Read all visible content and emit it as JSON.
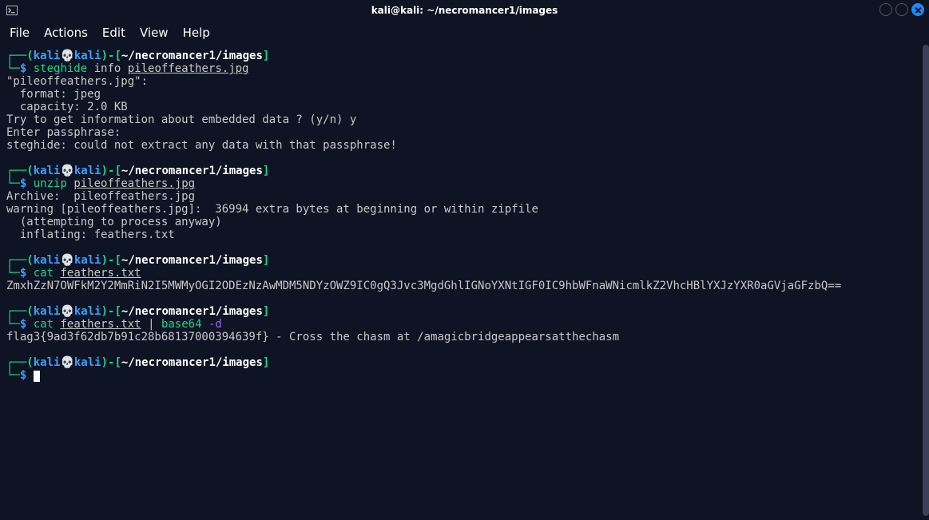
{
  "window": {
    "title": "kali@kali: ~/necromancer1/images"
  },
  "menu": {
    "file": "File",
    "actions": "Actions",
    "edit": "Edit",
    "view": "View",
    "help": "Help"
  },
  "prompt": {
    "user": "kali",
    "host": "kali",
    "path": "~/necromancer1/images",
    "skull": "💀"
  },
  "cmd1": {
    "bin": "steghide",
    "args": "info",
    "file": "pileoffeathers.jpg"
  },
  "out1": {
    "l1": "\"pileoffeathers.jpg\":",
    "l2": "  format: jpeg",
    "l3": "  capacity: 2.0 KB",
    "l4": "Try to get information about embedded data ? (y/n) y",
    "l5": "Enter passphrase: ",
    "l6": "steghide: could not extract any data with that passphrase!"
  },
  "cmd2": {
    "bin": "unzip",
    "file": "pileoffeathers.jpg"
  },
  "out2": {
    "l1": "Archive:  pileoffeathers.jpg",
    "l2": "warning [pileoffeathers.jpg]:  36994 extra bytes at beginning or within zipfile",
    "l3": "  (attempting to process anyway)",
    "l4": "  inflating: feathers.txt            "
  },
  "cmd3": {
    "bin": "cat",
    "file": "feathers.txt"
  },
  "out3": {
    "l1": "ZmxhZzN7OWFkM2Y2MmRiN2I5MWMyOGI2ODEzNzAwMDM5NDYzOWZ9IC0gQ3Jvc3MgdGhlIGNoYXNtIGF0IC9hbWFnaWNicmlkZ2VhcHBlYXJzYXR0aGVjaGFzbQ=="
  },
  "cmd4": {
    "bin": "cat",
    "file": "feathers.txt",
    "pipe": "|",
    "bin2": "base64",
    "flag": "-d"
  },
  "out4": {
    "l1": "flag3{9ad3f62db7b91c28b68137000394639f} - Cross the chasm at /amagicbridgeappearsatthechasm"
  }
}
